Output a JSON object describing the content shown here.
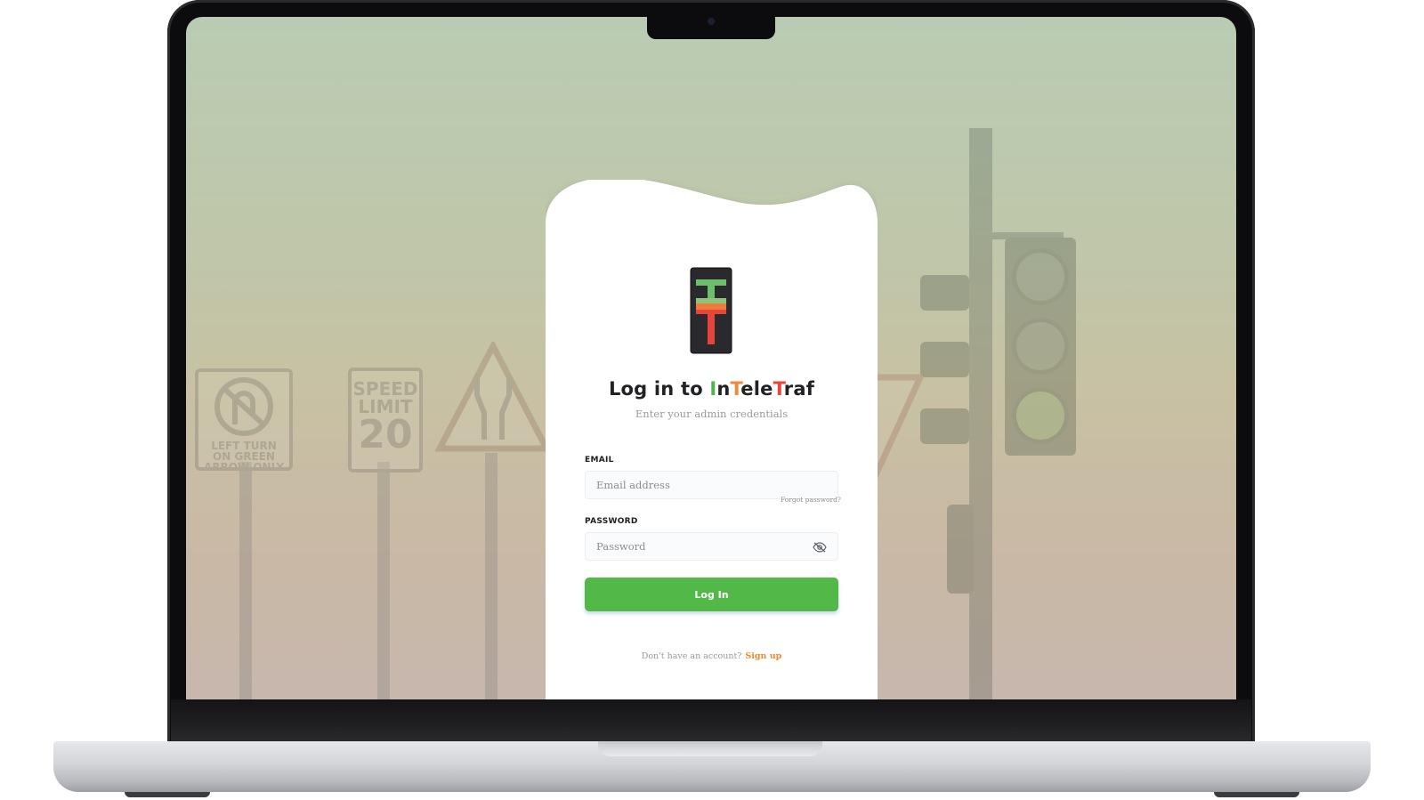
{
  "login": {
    "title_prefix": "Log in to ",
    "brand": {
      "part1": "I",
      "part2": "n",
      "part3": "T",
      "part4": "ele",
      "part5": "T",
      "part6": "raf"
    },
    "subtitle": "Enter your admin credentials",
    "email_label": "EMAIL",
    "email_placeholder": "Email address",
    "forgot_password": "Forgot password?",
    "password_label": "PASSWORD",
    "password_placeholder": "Password",
    "login_button": "Log In",
    "signup_prompt": "Don't have an account?",
    "signup_link": "Sign up"
  },
  "background_signs": {
    "sign1_lines": [
      "LEFT TURN",
      "ON GREEN",
      "ARROW ONLY"
    ],
    "sign2_line1": "SPEED",
    "sign2_line2": "LIMIT",
    "sign2_value": "20"
  },
  "icons": {
    "logo": "traffic-light-logo-icon",
    "password_toggle": "eye-slash-icon"
  },
  "colors": {
    "brand_green": "#52b848",
    "brand_orange": "#f08a3a",
    "brand_red": "#e8473a",
    "signup_link": "#f0882e"
  }
}
